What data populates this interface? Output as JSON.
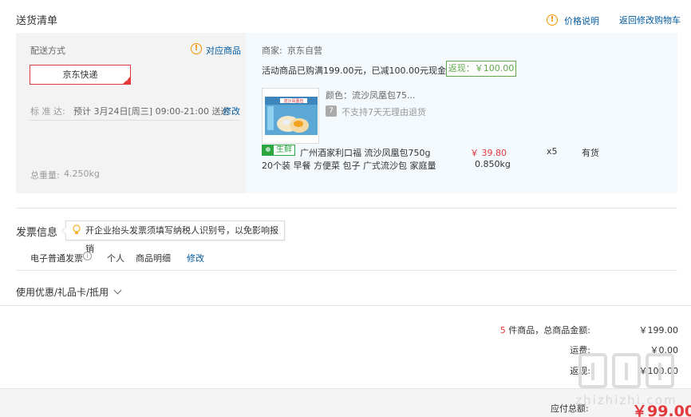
{
  "delivery": {
    "title": "送货清单",
    "price_info_label": "价格说明",
    "back_to_cart_label": "返回修改购物车"
  },
  "shipping": {
    "method_label": "配送方式",
    "matched_products_label": "对应商品",
    "selected_method": "京东快递",
    "standard_label": "标 准 达:",
    "standard_value": "预计 3月24日[周三] 09:00-21:00 送达",
    "modify_label": "修改",
    "total_weight_label": "总重量:",
    "total_weight_value": "4.250kg"
  },
  "seller": {
    "label": "商家:",
    "name": "京东自营",
    "promo_text": "活动商品已购满199.00元，已减100.00元现金",
    "rebate_tag": "返现：￥100.00"
  },
  "product": {
    "color_label": "颜色：流沙凤凰包75...",
    "no_return_text": "不支持7天无理由退货",
    "no_return_icon_text": "7",
    "fresh_tag": "生鲜",
    "name_line1": "广州酒家利口福 流沙凤凰包750g",
    "name_line2": "20个装 早餐 方便菜 包子 广式流沙包 家庭量",
    "price": "￥ 39.80",
    "weight": "0.850kg",
    "quantity": "x5",
    "stock": "有货",
    "package_text": "流沙凤凰包"
  },
  "invoice": {
    "title": "发票信息",
    "tip": "开企业抬头发票须填写纳税人识别号，以免影响报销",
    "type": "电子普通发票",
    "holder": "个人",
    "content": "商品明细",
    "modify_label": "修改"
  },
  "coupon": {
    "label": "使用优惠/礼品卡/抵用"
  },
  "summary": {
    "count": "5",
    "count_suffix": "件商品，总商品金额:",
    "goods_amount": "￥199.00",
    "freight_label": "运费:",
    "freight_value": "￥0.00",
    "rebate_label": "返现:",
    "rebate_value": "￥100.00",
    "total_label": "应付总额:",
    "total_value": "￥99.00"
  },
  "colors": {
    "accent_red": "#e4393c",
    "link_blue": "#005aa0",
    "rebate_green": "#5ea84b",
    "info_orange": "#f29400",
    "fresh_green": "#2da641"
  }
}
